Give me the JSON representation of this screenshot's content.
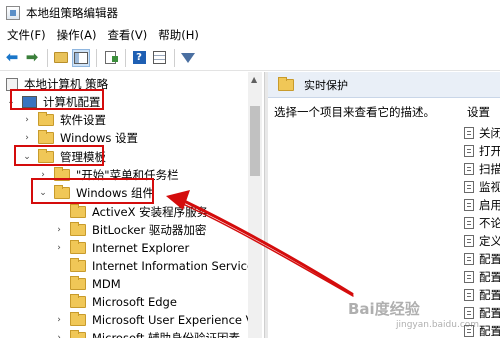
{
  "window": {
    "title": "本地组策略编辑器"
  },
  "menu": [
    "文件(F)",
    "操作(A)",
    "查看(V)",
    "帮助(H)"
  ],
  "toolbar": {
    "icons": [
      "back-arrow-icon",
      "forward-arrow-icon",
      "up-folder-icon",
      "show-hide-tree-icon",
      "export-list-icon",
      "help-icon",
      "properties-grid-icon",
      "filter-icon"
    ]
  },
  "tree": {
    "root": "本地计算机 策略",
    "computer_config": "计算机配置",
    "software_settings": "软件设置",
    "windows_settings": "Windows 设置",
    "admin_templates": "管理模板",
    "start_menu": "\"开始\"菜单和任务栏",
    "windows_components": "Windows 组件",
    "children": [
      "ActiveX 安装程序服务",
      "BitLocker 驱动器加密",
      "Internet Explorer",
      "Internet Information Services",
      "MDM",
      "Microsoft Edge",
      "Microsoft User Experience Vir",
      "Microsoft 辅助身份验证因素"
    ]
  },
  "right": {
    "header": "实时保护",
    "description": "选择一个项目来查看它的描述。",
    "settings_header": "设置",
    "settings": [
      "关闭",
      "打开",
      "扫描",
      "监视",
      "启用",
      "不论",
      "定义",
      "配置",
      "配置",
      "配置",
      "配置",
      "配置"
    ]
  },
  "watermark": {
    "text": "Bai度经验",
    "sub": "jingyan.baidu.com"
  },
  "annotation": {
    "box_color": "#d40c0c",
    "arrow_color": "#d40c0c"
  }
}
